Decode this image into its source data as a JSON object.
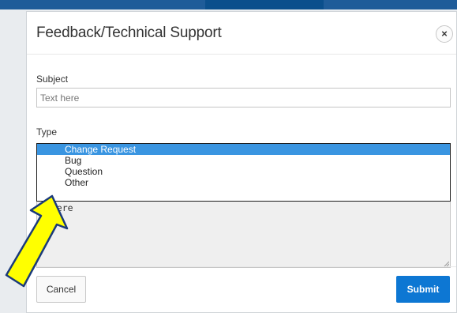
{
  "modal": {
    "title": "Feedback/Technical Support",
    "close_symbol": "×"
  },
  "form": {
    "subject_label": "Subject",
    "subject_placeholder": "Text here",
    "type_label": "Type",
    "type_options": [
      "Change Request",
      "Bug",
      "Question",
      "Other"
    ],
    "type_selected": "Change Request",
    "description_placeholder_visible": "t here"
  },
  "footer": {
    "cancel_label": "Cancel",
    "submit_label": "Submit"
  },
  "colors": {
    "submit": "#0d77d3",
    "selected_option": "#3a95e1",
    "annotation_arrow_fill": "#ffff00",
    "topbar": "#1f5c99"
  },
  "icons": {
    "close": "close-icon",
    "annotation": "yellow-arrow-annotation"
  }
}
